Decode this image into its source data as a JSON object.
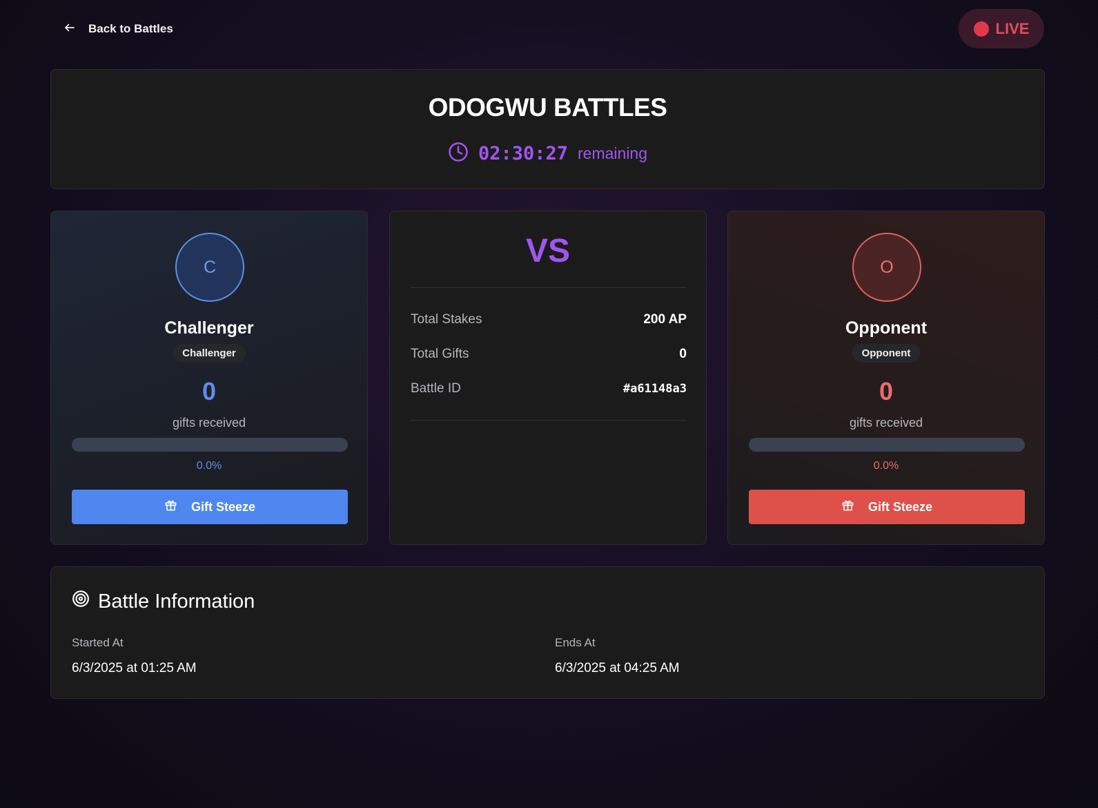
{
  "nav": {
    "back_label": "Back to Battles",
    "live_label": "LIVE"
  },
  "header": {
    "title": "ODOGWU BATTLES",
    "timer": "02:30:27",
    "timer_suffix": "remaining"
  },
  "challenger": {
    "initial": "C",
    "name": "Challenger",
    "role": "Challenger",
    "score": "0",
    "score_label": "gifts received",
    "percent": "0.0%",
    "progress": 0,
    "button_label": "Gift Steeze"
  },
  "opponent": {
    "initial": "O",
    "name": "Opponent",
    "role": "Opponent",
    "score": "0",
    "score_label": "gifts received",
    "percent": "0.0%",
    "progress": 0,
    "button_label": "Gift Steeze"
  },
  "versus": {
    "label": "VS",
    "stats": [
      {
        "label": "Total Stakes",
        "value": "200 AP"
      },
      {
        "label": "Total Gifts",
        "value": "0"
      },
      {
        "label": "Battle ID",
        "value": "#a61148a3"
      }
    ]
  },
  "info": {
    "title": "Battle Information",
    "started_label": "Started At",
    "started_value": "6/3/2025 at 01:25 AM",
    "ends_label": "Ends At",
    "ends_value": "6/3/2025 at 04:25 AM"
  },
  "colors": {
    "accent": "#a155ee",
    "challenger": "#4f86f0",
    "opponent": "#de504a",
    "live": "#e0394a"
  }
}
